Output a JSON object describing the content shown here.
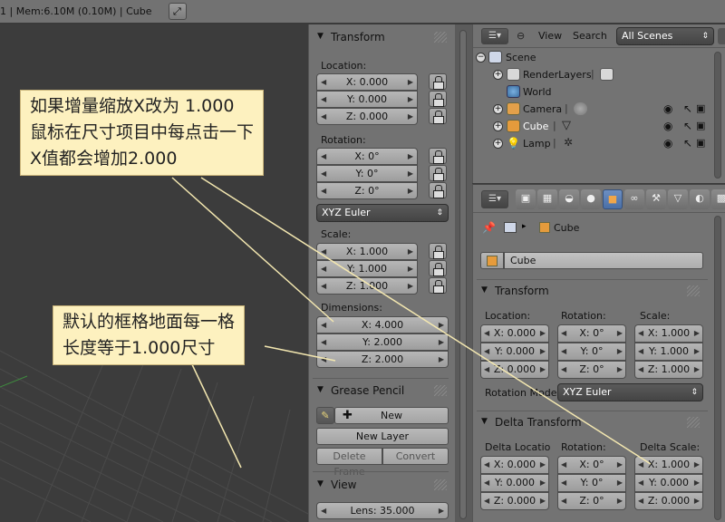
{
  "topbar": {
    "info": "1 | Mem:6.10M (0.10M) | Cube"
  },
  "npanel": {
    "transform": {
      "title": "Transform",
      "location_label": "Location:",
      "location": [
        "X: 0.000",
        "Y: 0.000",
        "Z: 0.000"
      ],
      "rotation_label": "Rotation:",
      "rotation": [
        "X: 0°",
        "Y: 0°",
        "Z: 0°"
      ],
      "rotation_mode": "XYZ Euler",
      "scale_label": "Scale:",
      "scale": [
        "X: 1.000",
        "Y: 1.000",
        "Z: 1.000"
      ],
      "dimensions_label": "Dimensions:",
      "dimensions": [
        "X: 4.000",
        "Y: 2.000",
        "Z: 2.000"
      ]
    },
    "grease_pencil": {
      "title": "Grease Pencil",
      "new": "New",
      "new_layer": "New Layer",
      "delete_frame": "Delete Frame",
      "convert": "Convert"
    },
    "view": {
      "title": "View",
      "lens": "Lens: 35.000"
    }
  },
  "outliner": {
    "header": {
      "view": "View",
      "search": "Search",
      "filter": "All Scenes"
    },
    "items": [
      {
        "label": "Scene"
      },
      {
        "label": "RenderLayers"
      },
      {
        "label": "World"
      },
      {
        "label": "Camera"
      },
      {
        "label": "Cube"
      },
      {
        "label": "Lamp"
      }
    ]
  },
  "properties": {
    "breadcrumb": "Cube",
    "object_name": "Cube",
    "transform": {
      "title": "Transform",
      "location_label": "Location:",
      "rotation_label": "Rotation:",
      "scale_label": "Scale:",
      "location": [
        "X: 0.000",
        "Y: 0.000",
        "Z: 0.000"
      ],
      "rotation": [
        "X: 0°",
        "Y: 0°",
        "Z: 0°"
      ],
      "scale": [
        "X: 1.000",
        "Y: 1.000",
        "Z: 1.000"
      ],
      "rotation_mode_label": "Rotation Mode",
      "rotation_mode": "XYZ Euler"
    },
    "delta_transform": {
      "title": "Delta Transform",
      "location_label": "Delta Locatio",
      "rotation_label": "Rotation:",
      "scale_label": "Delta Scale:",
      "location": [
        "X: 0.000",
        "Y: 0.000",
        "Z: 0.000"
      ],
      "rotation": [
        "X: 0°",
        "Y: 0°",
        "Z: 0°"
      ],
      "scale": [
        "X: 1.000",
        "Y: 0.000",
        "Z: 0.000"
      ]
    }
  },
  "annotations": {
    "note1": [
      "如果增量缩放X改为 1.000",
      "鼠标在尺寸项目中每点击一下",
      "X值都会增加2.000"
    ],
    "note2": [
      "默认的框格地面每一格",
      "长度等于1.000尺寸"
    ],
    "note_bg": "#fdf1bf",
    "line_color": "#f3e7b0"
  },
  "colors": {
    "panel": "#727272",
    "viewport": "#3c3c3c",
    "active_tab": "#5479b3"
  },
  "icons": [
    "fullscreen-icon",
    "lock-icon",
    "pencil-icon",
    "plus-icon",
    "eye-icon",
    "cursor-icon",
    "camera-render-icon",
    "pin-icon",
    "cube-icon"
  ]
}
